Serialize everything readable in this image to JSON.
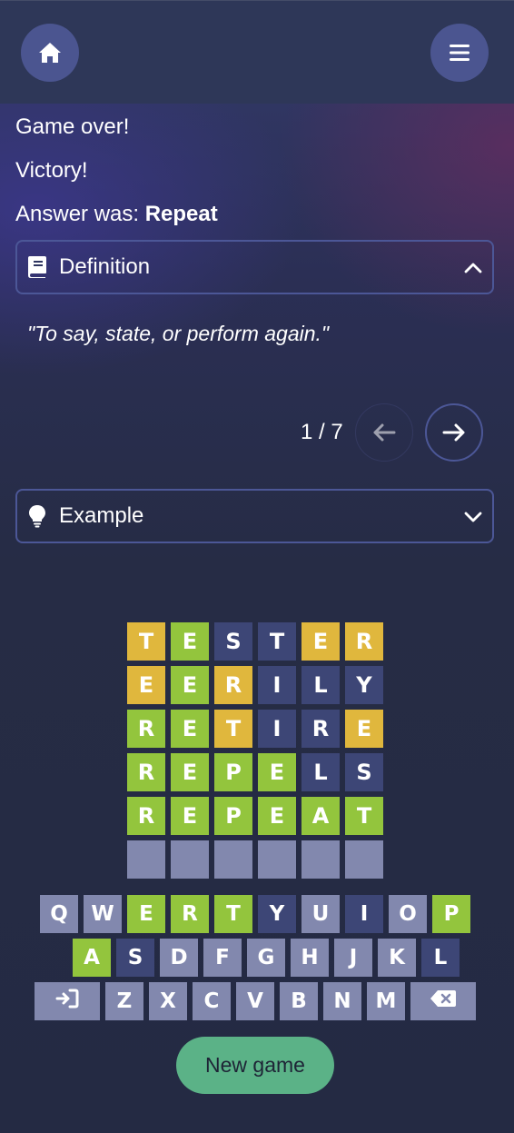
{
  "status": {
    "game_over": "Game over!",
    "result": "Victory!",
    "answer_prefix": "Answer was: ",
    "answer_word": "Repeat"
  },
  "definition": {
    "label": "Definition",
    "icon": "book-icon",
    "expanded": true,
    "text": "\"To say, state, or perform again.\"",
    "pager": "1 / 7"
  },
  "example": {
    "label": "Example",
    "icon": "lightbulb-icon",
    "expanded": false
  },
  "board": [
    [
      {
        "l": "T",
        "s": "yellow"
      },
      {
        "l": "E",
        "s": "green"
      },
      {
        "l": "S",
        "s": "dark"
      },
      {
        "l": "T",
        "s": "dark"
      },
      {
        "l": "E",
        "s": "yellow"
      },
      {
        "l": "R",
        "s": "yellow"
      }
    ],
    [
      {
        "l": "E",
        "s": "yellow"
      },
      {
        "l": "E",
        "s": "green"
      },
      {
        "l": "R",
        "s": "yellow"
      },
      {
        "l": "I",
        "s": "dark"
      },
      {
        "l": "L",
        "s": "dark"
      },
      {
        "l": "Y",
        "s": "dark"
      }
    ],
    [
      {
        "l": "R",
        "s": "green"
      },
      {
        "l": "E",
        "s": "green"
      },
      {
        "l": "T",
        "s": "yellow"
      },
      {
        "l": "I",
        "s": "dark"
      },
      {
        "l": "R",
        "s": "dark"
      },
      {
        "l": "E",
        "s": "yellow"
      }
    ],
    [
      {
        "l": "R",
        "s": "green"
      },
      {
        "l": "E",
        "s": "green"
      },
      {
        "l": "P",
        "s": "green"
      },
      {
        "l": "E",
        "s": "green"
      },
      {
        "l": "L",
        "s": "dark"
      },
      {
        "l": "S",
        "s": "dark"
      }
    ],
    [
      {
        "l": "R",
        "s": "green"
      },
      {
        "l": "E",
        "s": "green"
      },
      {
        "l": "P",
        "s": "green"
      },
      {
        "l": "E",
        "s": "green"
      },
      {
        "l": "A",
        "s": "green"
      },
      {
        "l": "T",
        "s": "green"
      }
    ],
    [
      {
        "l": "",
        "s": "empty"
      },
      {
        "l": "",
        "s": "empty"
      },
      {
        "l": "",
        "s": "empty"
      },
      {
        "l": "",
        "s": "empty"
      },
      {
        "l": "",
        "s": "empty"
      },
      {
        "l": "",
        "s": "empty"
      }
    ]
  ],
  "keyboard": {
    "row1": [
      {
        "k": "Q",
        "s": "light"
      },
      {
        "k": "W",
        "s": "light"
      },
      {
        "k": "E",
        "s": "green"
      },
      {
        "k": "R",
        "s": "green"
      },
      {
        "k": "T",
        "s": "green"
      },
      {
        "k": "Y",
        "s": "dark"
      },
      {
        "k": "U",
        "s": "light"
      },
      {
        "k": "I",
        "s": "dark"
      },
      {
        "k": "O",
        "s": "light"
      },
      {
        "k": "P",
        "s": "green"
      }
    ],
    "row2": [
      {
        "k": "A",
        "s": "green"
      },
      {
        "k": "S",
        "s": "dark"
      },
      {
        "k": "D",
        "s": "light"
      },
      {
        "k": "F",
        "s": "light"
      },
      {
        "k": "G",
        "s": "light"
      },
      {
        "k": "H",
        "s": "light"
      },
      {
        "k": "J",
        "s": "light"
      },
      {
        "k": "K",
        "s": "light"
      },
      {
        "k": "L",
        "s": "dark"
      }
    ],
    "row3": [
      {
        "k": "",
        "s": "light",
        "icon": "enter-icon",
        "wide": true
      },
      {
        "k": "Z",
        "s": "light"
      },
      {
        "k": "X",
        "s": "light"
      },
      {
        "k": "C",
        "s": "light"
      },
      {
        "k": "V",
        "s": "light"
      },
      {
        "k": "B",
        "s": "light"
      },
      {
        "k": "N",
        "s": "light"
      },
      {
        "k": "M",
        "s": "light"
      },
      {
        "k": "",
        "s": "light",
        "icon": "backspace-icon",
        "wide": true
      }
    ]
  },
  "new_game_label": "New game",
  "colors": {
    "correct": "#93c53d",
    "present": "#e0b73d",
    "absent": "#3d4676",
    "unused": "#8288ae",
    "new_game": "#5bb287"
  }
}
